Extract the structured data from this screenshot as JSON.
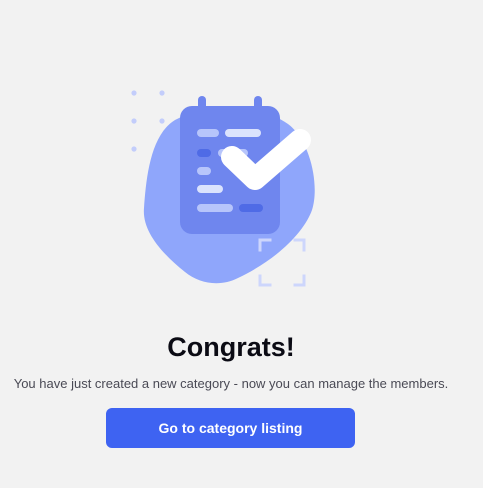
{
  "success": {
    "title": "Congrats!",
    "message": "You have just created a new category - now you can manage the members.",
    "cta_label": "Go to category listing"
  },
  "illustration": {
    "icon": "clipboard-check-icon",
    "colors": {
      "blob": "#8fa6fb",
      "clipboard": "#6f86ee",
      "lines_light": "#b7c5fb",
      "lines_dark": "#4f6be6",
      "check": "#ffffff",
      "dots": "#c3cdfb",
      "focus_frame": "#cdd6fc"
    }
  },
  "theme": {
    "background": "#f2f2f2",
    "accent": "#3e63f2",
    "title_color": "#0b0b14",
    "text_color": "#4a4a55"
  }
}
